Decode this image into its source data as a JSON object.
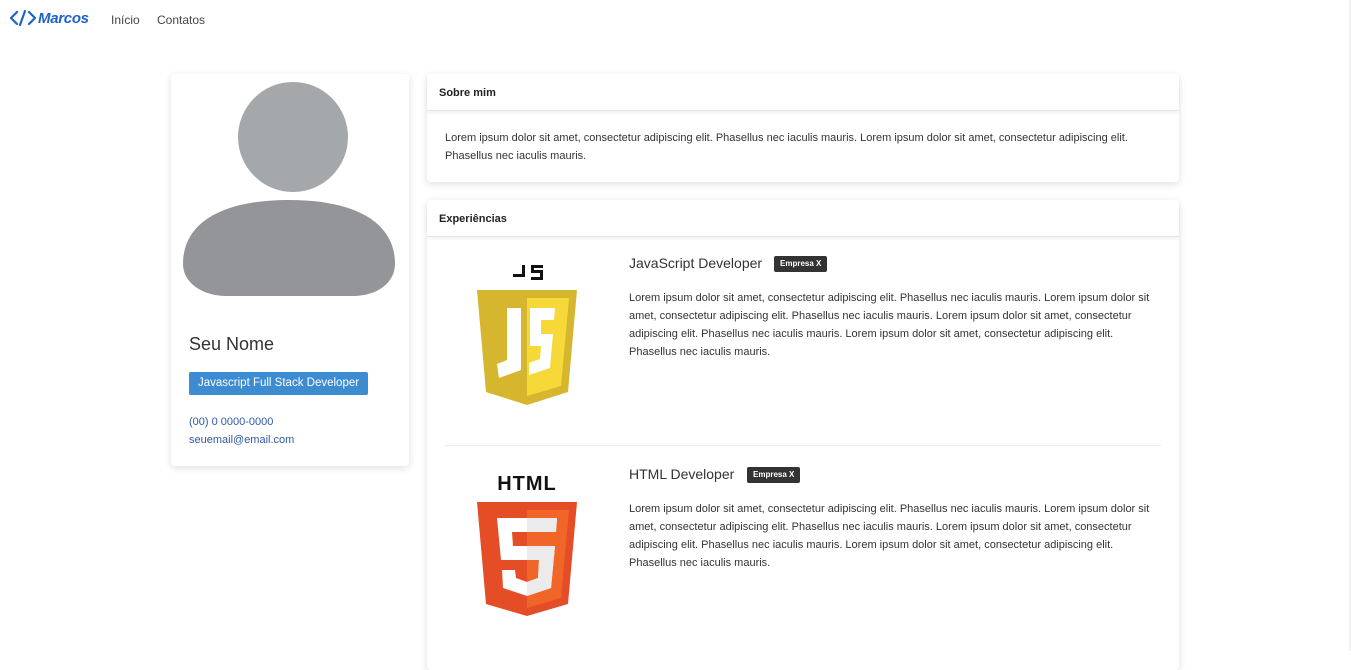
{
  "navbar": {
    "brand_symbol": "</>",
    "brand_text": "Marcos",
    "links": [
      "Início",
      "Contatos"
    ]
  },
  "profile": {
    "name": "Seu Nome",
    "role": "Javascript Full Stack Developer",
    "phone": "(00) 0 0000-0000",
    "email": "seuemail@email.com",
    "avatar_icon": "user-silhouette-icon"
  },
  "about": {
    "title": "Sobre mim",
    "text": "Lorem ipsum dolor sit amet, consectetur adipiscing elit. Phasellus nec iaculis mauris. Lorem ipsum dolor sit amet, consectetur adipiscing elit. Phasellus nec iaculis mauris."
  },
  "experiences": {
    "title": "Experiências",
    "items": [
      {
        "title": "JavaScript Developer",
        "company": "Empresa X",
        "logo_label": "JS",
        "logo_icon": "javascript-logo-icon",
        "description": "Lorem ipsum dolor sit amet, consectetur adipiscing elit. Phasellus nec iaculis mauris. Lorem ipsum dolor sit amet, consectetur adipiscing elit. Phasellus nec iaculis mauris. Lorem ipsum dolor sit amet, consectetur adipiscing elit. Phasellus nec iaculis mauris. Lorem ipsum dolor sit amet, consectetur adipiscing elit. Phasellus nec iaculis mauris."
      },
      {
        "title": "HTML Developer",
        "company": "Empresa X",
        "logo_label": "HTML",
        "logo_icon": "html5-logo-icon",
        "description": "Lorem ipsum dolor sit amet, consectetur adipiscing elit. Phasellus nec iaculis mauris. Lorem ipsum dolor sit amet, consectetur adipiscing elit. Phasellus nec iaculis mauris. Lorem ipsum dolor sit amet, consectetur adipiscing elit. Phasellus nec iaculis mauris. Lorem ipsum dolor sit amet, consectetur adipiscing elit. Phasellus nec iaculis mauris."
      }
    ]
  },
  "colors": {
    "brand": "#1f63c9",
    "role_badge": "#3d8bd0",
    "link": "#2e5aa8",
    "company_badge": "#333333",
    "avatar": "#a5a8ab",
    "js_shield": "#d6b62e",
    "html_shield": "#e44d26"
  }
}
